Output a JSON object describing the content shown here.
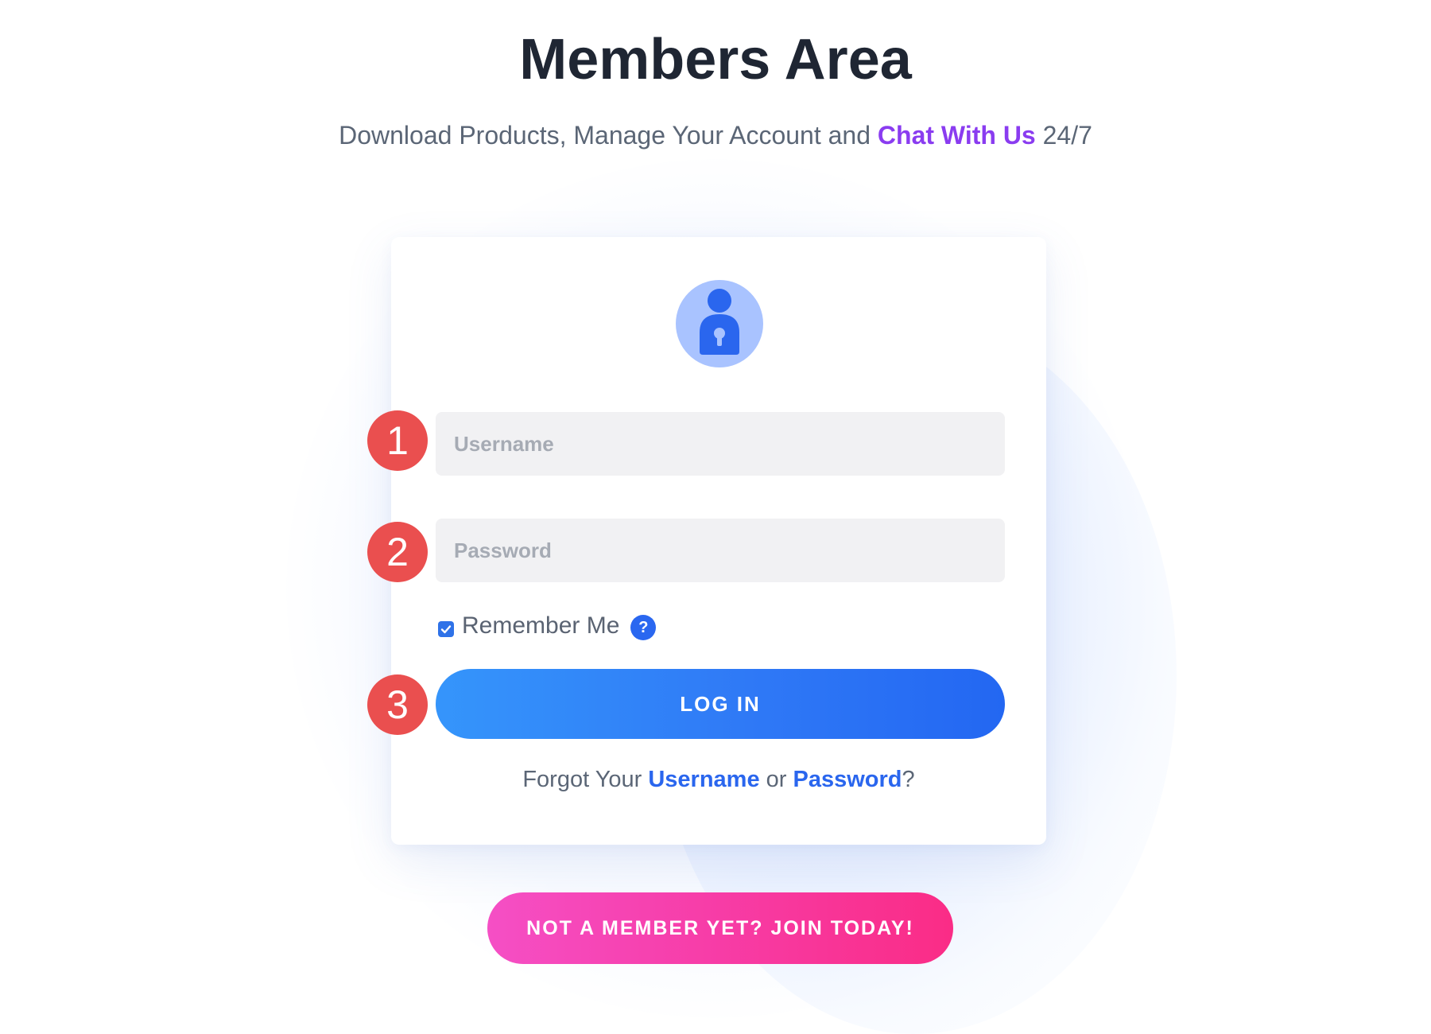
{
  "header": {
    "title": "Members Area",
    "subtitle_prefix": "Download Products, Manage Your Account and ",
    "subtitle_link": "Chat With Us",
    "subtitle_suffix": " 24/7"
  },
  "login_form": {
    "avatar_icon": "user-lock-icon",
    "steps": [
      "1",
      "2",
      "3"
    ],
    "username_placeholder": "Username",
    "username_value": "",
    "password_placeholder": "Password",
    "password_value": "",
    "remember_label": "Remember Me",
    "remember_checked": true,
    "help_icon": "?",
    "login_label": "LOG IN",
    "forgot_prefix": "Forgot Your ",
    "forgot_username": "Username",
    "forgot_or": " or ",
    "forgot_password": "Password",
    "forgot_suffix": "?"
  },
  "join": {
    "label": "NOT A MEMBER YET? JOIN TODAY!"
  },
  "colors": {
    "accent_blue": "#2f79f6",
    "link_purple": "#8a3cf0",
    "step_red": "#ea4f4f",
    "join_pink": "#f73ca6"
  }
}
